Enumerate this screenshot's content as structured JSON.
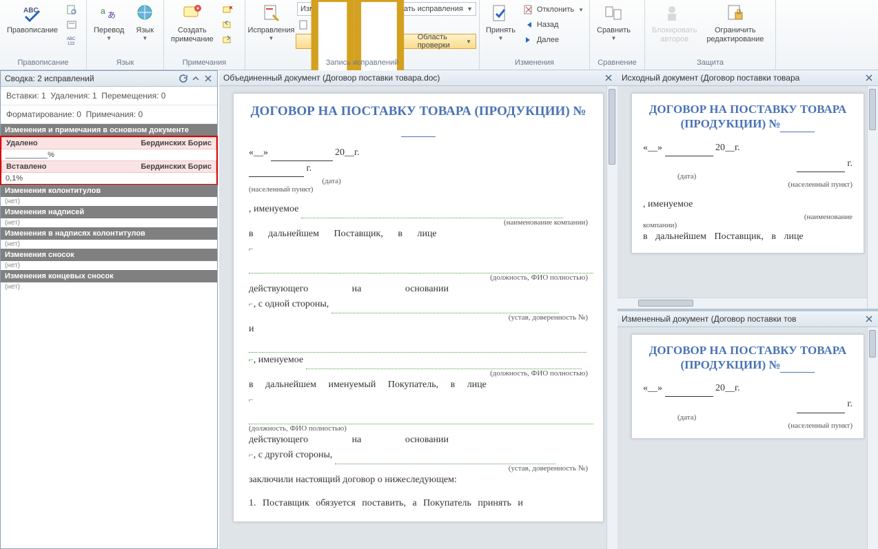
{
  "ribbon": {
    "groups": {
      "spelling": {
        "label": "Правописание",
        "btn": "Правописание"
      },
      "language": {
        "label": "Язык",
        "translate": "Перевод",
        "lang": "Язык"
      },
      "comments": {
        "label": "Примечания",
        "new": "Создать\nпримечание"
      },
      "tracking": {
        "label": "Запись исправлений",
        "track": "Исправления",
        "combo": "Измененный документ: показать исправления",
        "show": "Показать исправления",
        "pane": "Область проверки"
      },
      "changes": {
        "label": "Изменения",
        "accept": "Принять",
        "reject": "Отклонить",
        "back": "Назад",
        "next": "Далее"
      },
      "compare": {
        "label": "Сравнение",
        "btn": "Сравнить"
      },
      "protect": {
        "label": "Защита",
        "block": "Блокировать\nавторов",
        "restrict": "Ограничить\nредактирование"
      }
    }
  },
  "summary": {
    "title": "Сводка: 2 исправлений",
    "line1a": "Вставки: 1",
    "line1b": "Удаления: 1",
    "line1c": "Перемещения: 0",
    "line2a": "Форматирование: 0",
    "line2b": "Примечания: 0",
    "sec_main": "Изменения и примечания в основном документе",
    "del_label": "Удалено",
    "del_author": "Бердинских Борис",
    "del_text": "__________%",
    "ins_label": "Вставлено",
    "ins_author": "Бердинских Борис",
    "ins_text": "0,1%",
    "sec_hf": "Изменения колонтитулов",
    "sec_cap": "Изменения надписей",
    "sec_hfcap": "Изменения в надписях колонтитулов",
    "sec_fn": "Изменения сносок",
    "sec_en": "Изменения концевых сносок",
    "none": "(нет)"
  },
  "center_pane": {
    "title": "Объединенный документ (Договор поставки товара.doc)"
  },
  "right_top": {
    "title": "Исходный документ (Договор поставки товара"
  },
  "right_bottom": {
    "title": "Измененный документ (Договор поставки тов"
  },
  "doc": {
    "title_ru": "ДОГОВОР НА ПОСТАВКУ ТОВАРА (ПРОДУКЦИИ) №",
    "quote_open": "«__»",
    "year_prefix": "20__г.",
    "city_suffix": "г.",
    "date_label": "(дата)",
    "city_label": "(населенный пункт)",
    "named_as": ", именуемое",
    "company_label": "(наименование компании)",
    "supplier_line": "в дальнейшем Поставщик, в лице",
    "position_label": "(должность, ФИО полностью)",
    "acting_on": "действующего на основании",
    "side1": ", с одной стороны,",
    "charter_label": "(устав, доверенность №)",
    "and": "и",
    "buyer_line": "в дальнейшем именуемый Покупатель, в лице",
    "side2": ", с другой стороны,",
    "concluded": "заключили настоящий договор о нижеследующем:",
    "clause1": "1. Поставщик обязуется поставить, а Покупатель принять и"
  }
}
